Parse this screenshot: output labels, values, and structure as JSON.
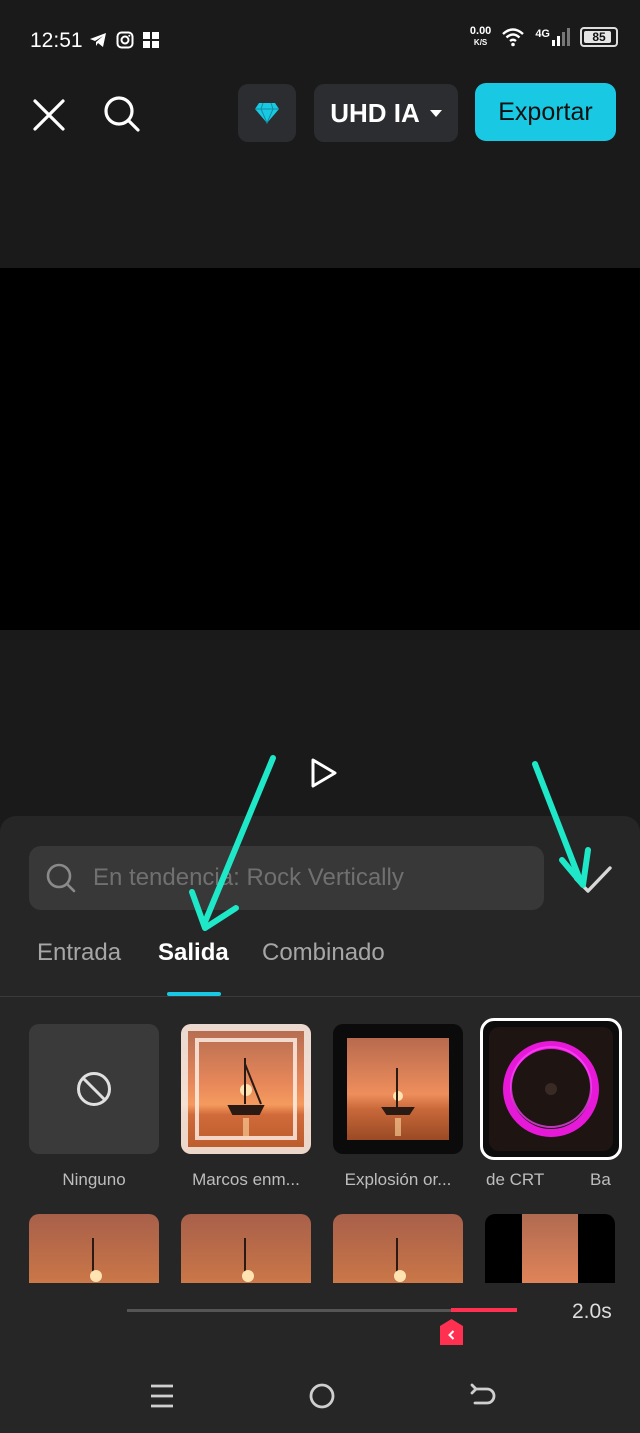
{
  "status": {
    "time": "12:51",
    "net_speed_top": "0.00",
    "net_speed_bottom": "K/S",
    "network": "4G",
    "battery": "85"
  },
  "toolbar": {
    "quality_label": "UHD IA",
    "export_label": "Exportar"
  },
  "effects_panel": {
    "search_placeholder": "En tendencia: Rock Vertically",
    "tabs": [
      {
        "label": "Entrada",
        "active": false
      },
      {
        "label": "Salida",
        "active": true
      },
      {
        "label": "Combinado",
        "active": false
      }
    ],
    "items": [
      {
        "label": "Ninguno",
        "icon": "none-icon"
      },
      {
        "label": "Marcos enm..."
      },
      {
        "label": "Explosión or..."
      },
      {
        "label": "de CRT",
        "selected": true
      },
      {
        "label": "Ba"
      }
    ]
  },
  "timeline": {
    "duration": "2.0s"
  },
  "colors": {
    "accent": "#19c9e3",
    "highlight_ring": "#e619d8",
    "timeline_red": "#ff3050"
  }
}
